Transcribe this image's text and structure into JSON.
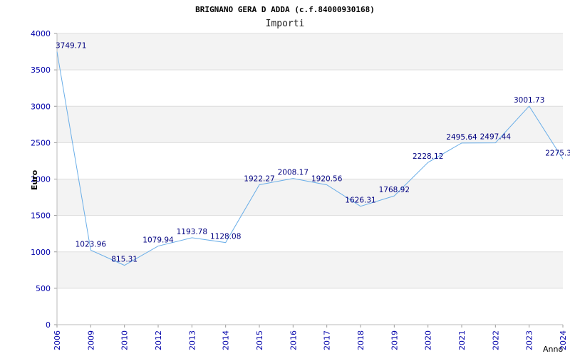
{
  "chart_data": {
    "type": "line",
    "title": "BRIGNANO GERA D ADDA (c.f.84000930168)",
    "subtitle": "Importi",
    "xlabel": "Anno",
    "ylabel": "Euro",
    "ylim": [
      0,
      4000
    ],
    "yticks": [
      0,
      500,
      1000,
      1500,
      2000,
      2500,
      3000,
      3500,
      4000
    ],
    "grid": "horizontal-bands",
    "line_color": "#6aaee8",
    "band_color": "#f3f3f3",
    "x": [
      "2006",
      "2009",
      "2010",
      "2012",
      "2013",
      "2014",
      "2015",
      "2016",
      "2017",
      "2018",
      "2019",
      "2020",
      "2021",
      "2022",
      "2023",
      "2024"
    ],
    "values": [
      3749.71,
      1023.96,
      815.31,
      1079.94,
      1193.78,
      1128.08,
      1922.27,
      2008.17,
      1920.56,
      1626.31,
      1768.92,
      2228.12,
      2495.64,
      2497.44,
      3001.73,
      2275.3
    ],
    "labels": [
      "3749.71",
      "1023.96",
      "815.31",
      "1079.94",
      "1193.78",
      "1128.08",
      "1922.27",
      "2008.17",
      "1920.56",
      "1626.31",
      "1768.92",
      "2228.12",
      "2495.64",
      "2497.44",
      "3001.73",
      "2275.3"
    ]
  }
}
